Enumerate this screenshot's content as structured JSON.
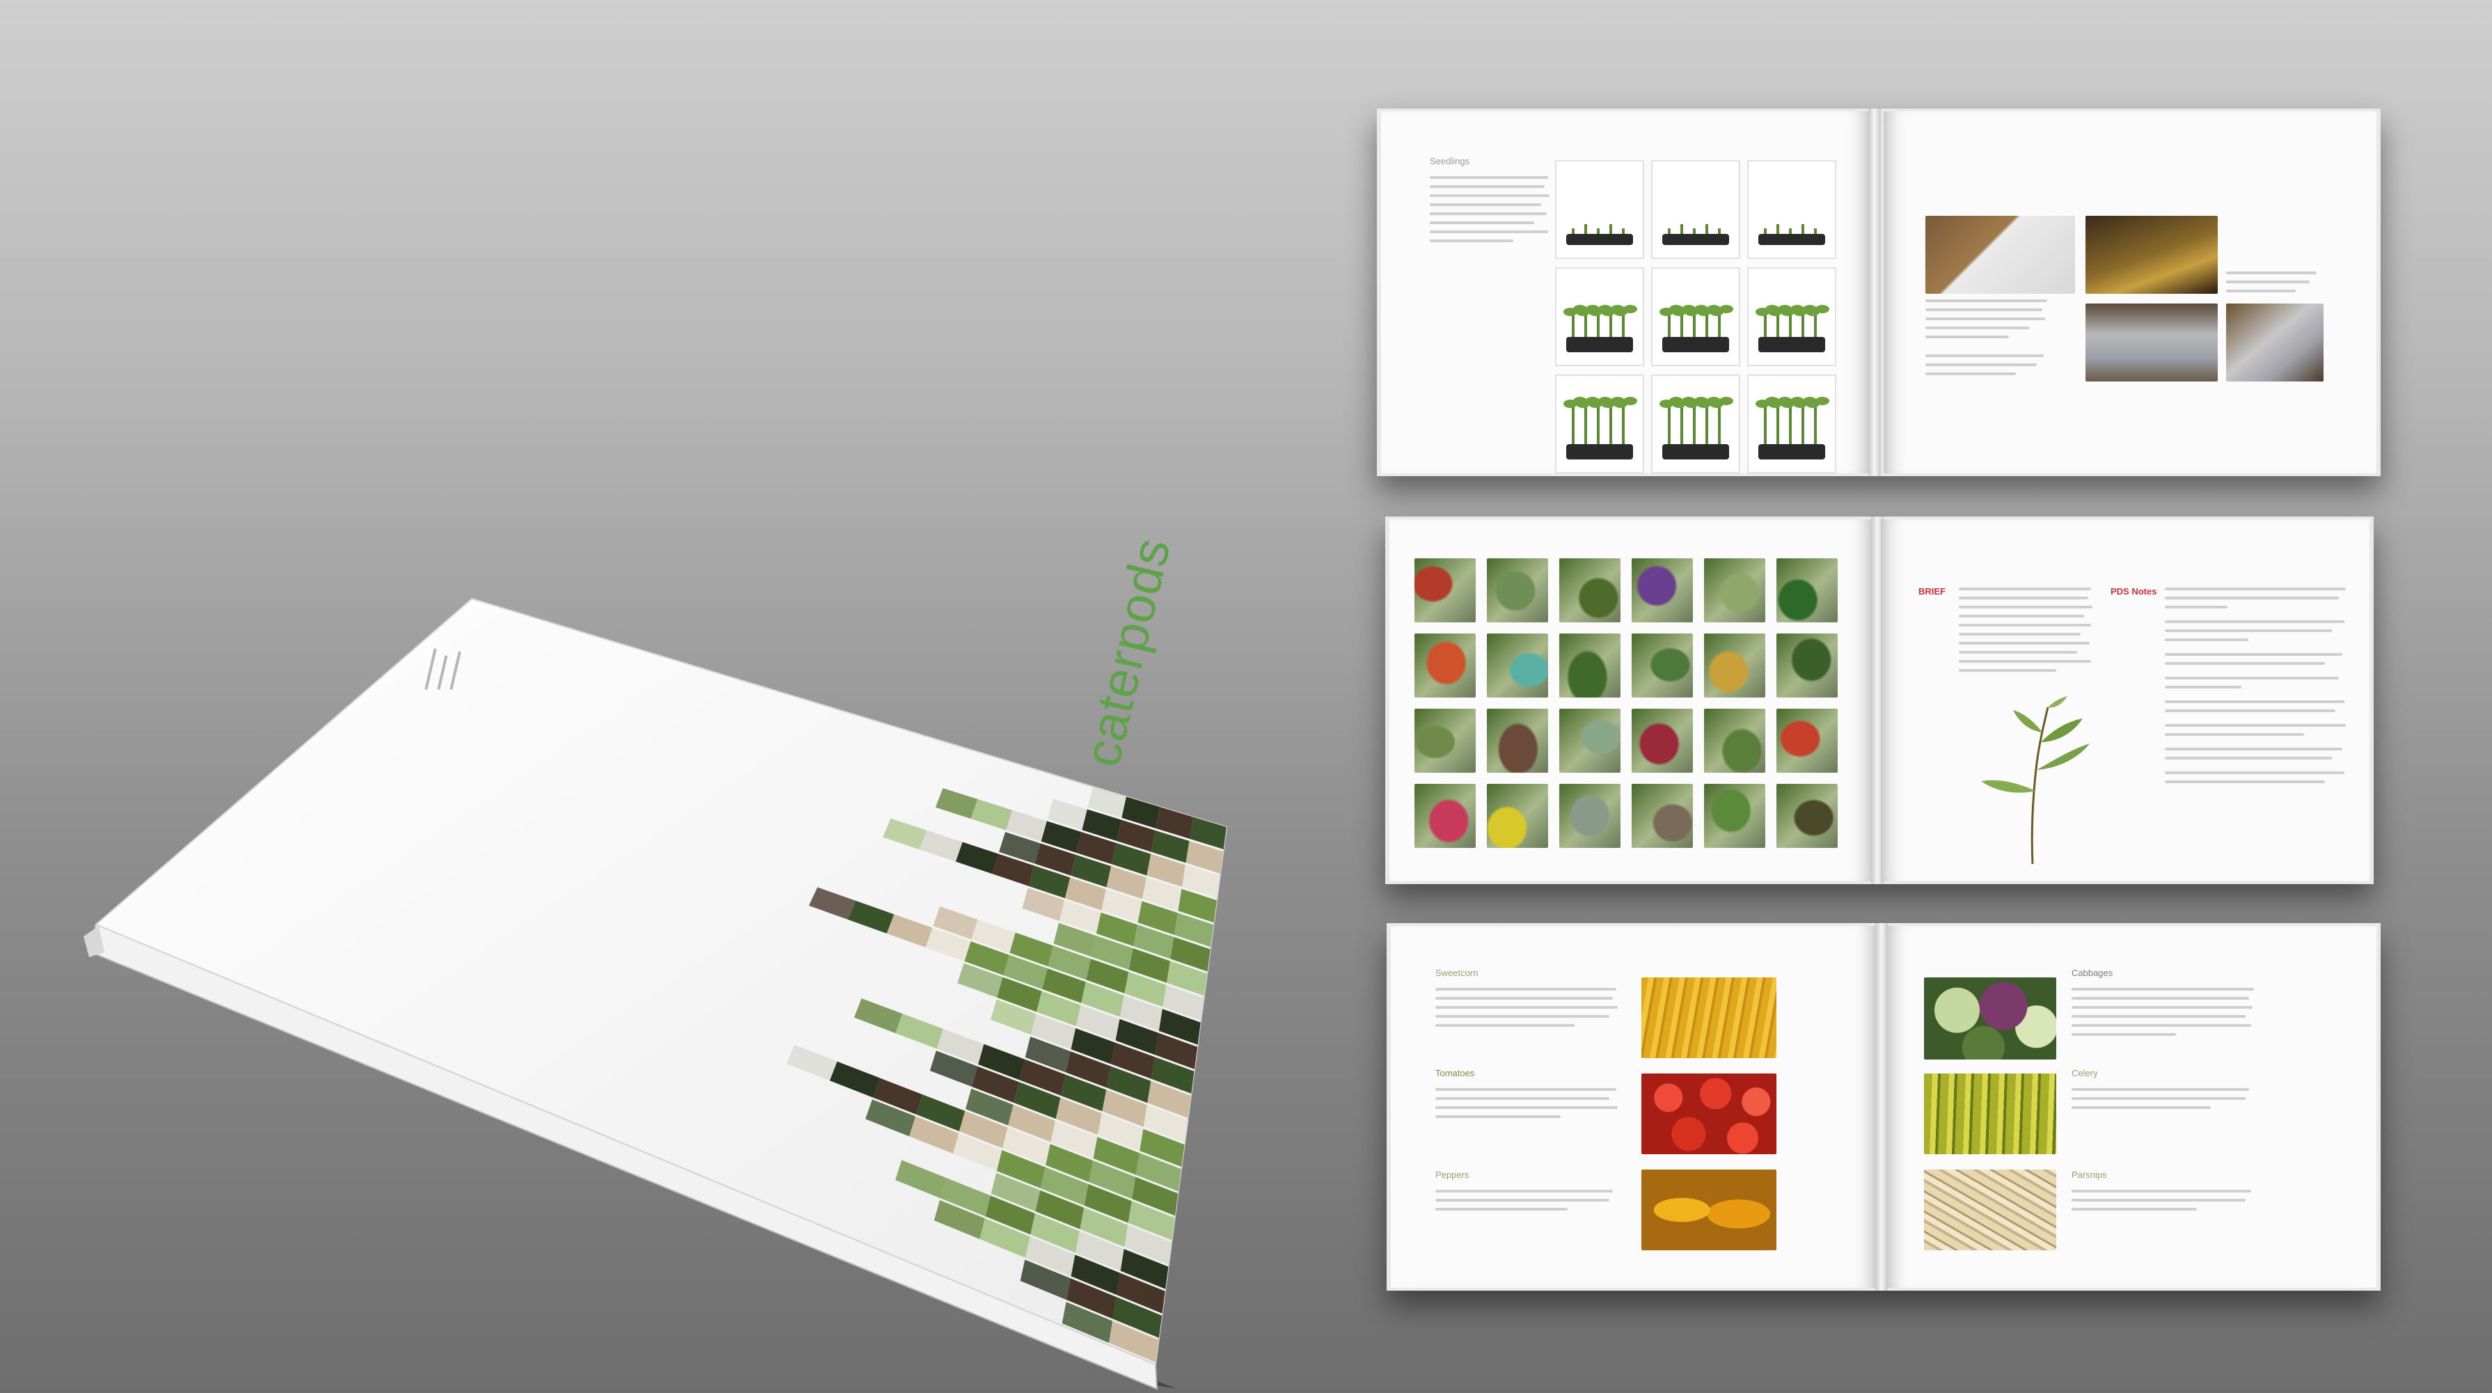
{
  "cover": {
    "title": "caterpods",
    "subtitle": "",
    "mosaic_colors": [
      "#2f4a1f",
      "#6b8f3d",
      "#a9c48a",
      "#3d2b1d",
      "#e8e4d9",
      "#5b7d2f",
      "#1e2a14",
      "#c9b79c",
      "#8aa968",
      "#d9d9d2"
    ]
  },
  "spreads": {
    "one": {
      "left_heading": "Seedlings",
      "left_subheading": "",
      "frame_labels": [
        "",
        "",
        "",
        "",
        "",
        "",
        "",
        "",
        ""
      ]
    },
    "two": {
      "brief_label": "BRIEF",
      "pds_label": "PDS Notes",
      "caterpillar_colors": [
        "#b43a2a",
        "#6e8f55",
        "#4d6b2a",
        "#6a3f8f",
        "#8fa86a",
        "#2d6a2a",
        "#d0522a",
        "#5ab0a3",
        "#3f6a2a",
        "#4d7a3a",
        "#c9a03a",
        "#3a5f2a",
        "#6f8a4a",
        "#6b4a3a",
        "#8aa78a",
        "#9a2a3a",
        "#5a7f3a",
        "#c8402a",
        "#c83a5a",
        "#d8c82a",
        "#8a9a8a",
        "#7a6a5a",
        "#5a8a3a",
        "#4a4a2a"
      ]
    },
    "three": {
      "veg_left": [
        "Sweetcorn",
        "Tomatoes",
        "Peppers"
      ],
      "veg_right": [
        "Cabbages",
        "Celery",
        "Parsnips"
      ]
    }
  }
}
